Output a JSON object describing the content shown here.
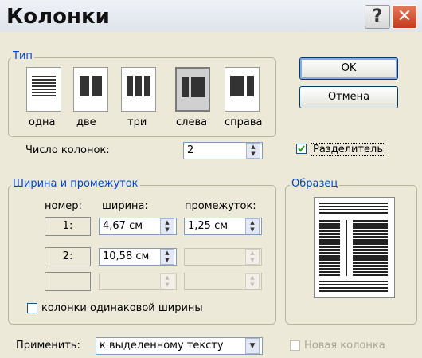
{
  "title": "Колонки",
  "title_buttons": {
    "help": "?",
    "close": "✕"
  },
  "type_group": {
    "label": "Тип",
    "options": [
      "одна",
      "две",
      "три",
      "слева",
      "справа"
    ],
    "selected": "слева"
  },
  "buttons": {
    "ok": "OK",
    "cancel": "Отмена"
  },
  "num_columns": {
    "label": "Число колонок:",
    "value": "2"
  },
  "separator": {
    "label": "Разделитель",
    "checked": true
  },
  "width_group": {
    "label": "Ширина и промежуток",
    "headers": {
      "number": "номер:",
      "width": "ширина:",
      "spacing": "промежуток:"
    },
    "rows": [
      {
        "number": "1:",
        "width": "4,67 см",
        "spacing": "1,25 см"
      },
      {
        "number": "2:",
        "width": "10,58 см",
        "spacing": ""
      },
      {
        "number": "",
        "width": "",
        "spacing": ""
      }
    ]
  },
  "equal_width": {
    "label": "колонки одинаковой ширины",
    "checked": false
  },
  "preview": {
    "label": "Образец"
  },
  "apply": {
    "label": "Применить:",
    "value": "к выделенному тексту"
  },
  "new_column": {
    "label": "Новая колонка",
    "checked": false,
    "disabled": true
  },
  "icons": {
    "help": "help-icon",
    "close": "close-icon",
    "spin": "spinner-arrows-icon",
    "dropdown": "chevron-down-icon"
  }
}
